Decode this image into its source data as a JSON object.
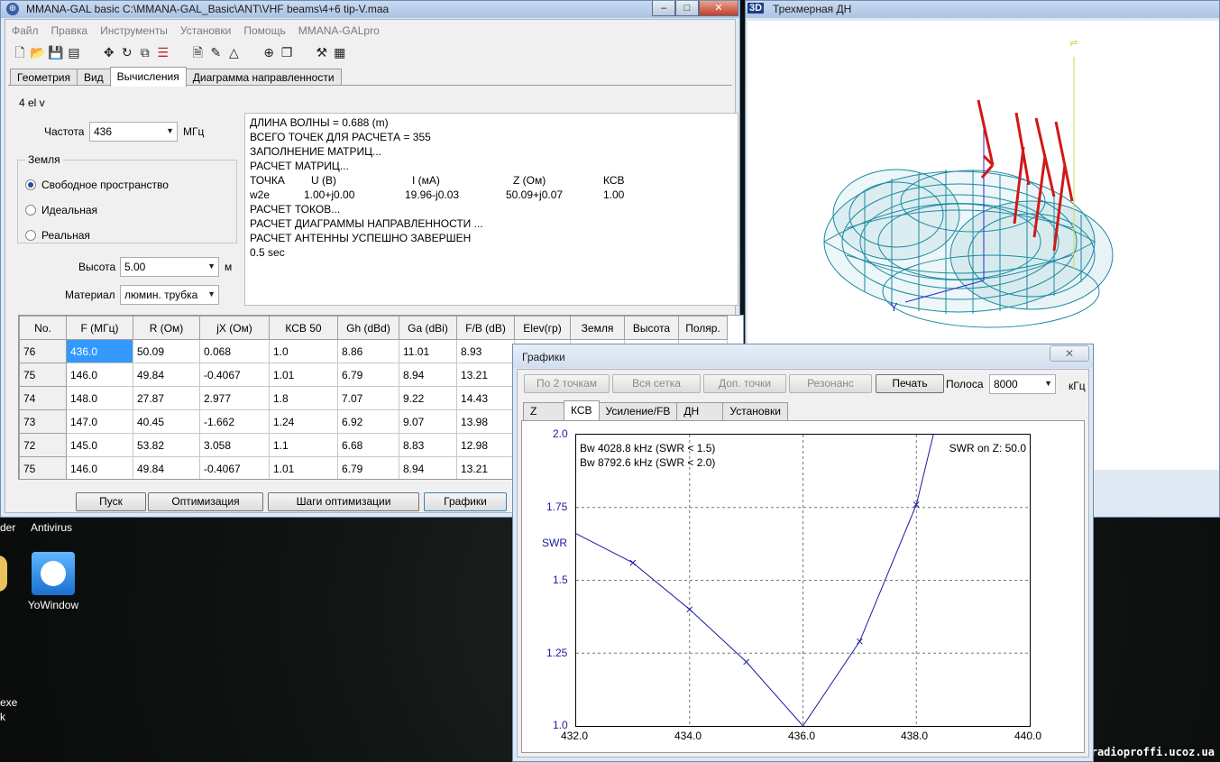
{
  "main": {
    "title": "MMANA-GAL basic C:\\MMANA-GAL_Basic\\ANT\\VHF beams\\4+6 tip-V.maa",
    "caption": {
      "minimize": "–",
      "maximize": "□",
      "close": "✕"
    },
    "menu": [
      "Файл",
      "Правка",
      "Инструменты",
      "Установки",
      "Помощь",
      "MMANA-GALpro"
    ],
    "tabs": [
      "Геометрия",
      "Вид",
      "Вычисления",
      "Диаграмма направленности"
    ],
    "active_tab": "Вычисления",
    "antenna_name": "4 el v",
    "freq_label": "Частота",
    "freq_value": "436",
    "freq_unit": "МГц",
    "ground_group": "Земля",
    "ground_options": [
      "Свободное пространство",
      "Идеальная",
      "Реальная"
    ],
    "ground_selected": "Свободное пространство",
    "height_label": "Высота",
    "height_value": "5.00",
    "height_unit": "м",
    "material_label": "Материал",
    "material_value": "люмин. трубка",
    "log": {
      "l1": "ДЛИНА ВОЛНЫ = 0.688 (m)",
      "l2": "ВСЕГО ТОЧЕК ДЛЯ РАСЧЕТА = 355",
      "l3": "ЗАПОЛНЕНИЕ МАТРИЦ...",
      "l4": "РАСЧЕТ МАТРИЦ...",
      "h": [
        "ТОЧКА",
        "U (В)",
        "I (мА)",
        "Z (Ом)",
        "КСВ"
      ],
      "r": [
        "w2e",
        "1.00+j0.00",
        "19.96-j0.03",
        "50.09+j0.07",
        "1.00"
      ],
      "l5": "РАСЧЕТ ТОКОВ...",
      "l6": "РАСЧЕТ ДИАГРАММЫ НАПРАВЛЕННОСТИ ...",
      "l7": "РАСЧЕТ АНТЕННЫ УСПЕШНО ЗАВЕРШЕН",
      "l8": "0.5 sec"
    },
    "table": {
      "headers": [
        "No.",
        "F (МГц)",
        "R (Ом)",
        "jX (Ом)",
        "КСВ 50",
        "Gh (dBd)",
        "Ga (dBi)",
        "F/B (dB)",
        "Elev(гр)",
        "Земля",
        "Высота",
        "Поляр."
      ],
      "rows": [
        [
          "76",
          "436.0",
          "50.09",
          "0.068",
          "1.0",
          "8.86",
          "11.01",
          "8.93"
        ],
        [
          "75",
          "146.0",
          "49.84",
          "-0.4067",
          "1.01",
          "6.79",
          "8.94",
          "13.21"
        ],
        [
          "74",
          "148.0",
          "27.87",
          "2.977",
          "1.8",
          "7.07",
          "9.22",
          "14.43"
        ],
        [
          "73",
          "147.0",
          "40.45",
          "-1.662",
          "1.24",
          "6.92",
          "9.07",
          "13.98"
        ],
        [
          "72",
          "145.0",
          "53.82",
          "3.058",
          "1.1",
          "6.68",
          "8.83",
          "12.98"
        ],
        [
          "75",
          "146.0",
          "49.84",
          "-0.4067",
          "1.01",
          "6.79",
          "8.94",
          "13.21"
        ]
      ]
    },
    "buttons": [
      "Пуск",
      "Оптимизация",
      "Шаги оптимизации",
      "Графики"
    ]
  },
  "win3d": {
    "tag": "3D",
    "title": "Трехмерная ДН",
    "axis_y": "Y"
  },
  "graph": {
    "title": "Графики",
    "close": "✕",
    "buttons": [
      "По 2 точкам",
      "Вся сетка",
      "Доп. точки",
      "Резонанс",
      "Печать"
    ],
    "band_label": "Полоса",
    "band_value": "8000",
    "band_unit": "кГц",
    "tabs": [
      "Z",
      "КСВ",
      "Усиление/FB",
      "ДН",
      "Установки"
    ],
    "active_tab": "КСВ",
    "bw1": "Bw 4028.8 kHz (SWR < 1.5)",
    "bw2": "Bw 8792.6 kHz (SWR < 2.0)",
    "swr_on_z": "SWR on Z: 50.0",
    "curve_color": "#1a1aa0"
  },
  "chart_data": {
    "type": "line",
    "ylabel": "SWR",
    "x_ticks": [
      "432.0",
      "434.0",
      "436.0",
      "438.0",
      "440.0"
    ],
    "y_ticks": [
      "1.0",
      "1.25",
      "1.5",
      "1.75",
      "2.0"
    ],
    "xlim": [
      432.0,
      440.0
    ],
    "ylim": [
      1.0,
      2.0
    ],
    "grid": true,
    "x": [
      432.0,
      433.0,
      434.0,
      435.0,
      436.0,
      437.0,
      438.0,
      438.3
    ],
    "y": [
      1.66,
      1.56,
      1.4,
      1.22,
      1.0,
      1.29,
      1.76,
      2.0
    ],
    "markers_at": [
      433.0,
      434.0,
      435.0,
      437.0,
      438.0
    ]
  },
  "desktop": {
    "icon1": "Antivirus",
    "icon2": "YoWindow",
    "frag1": "der",
    "frag2": "exe",
    "frag3": "k",
    "watermark": "radioproffi.ucoz.ua"
  }
}
